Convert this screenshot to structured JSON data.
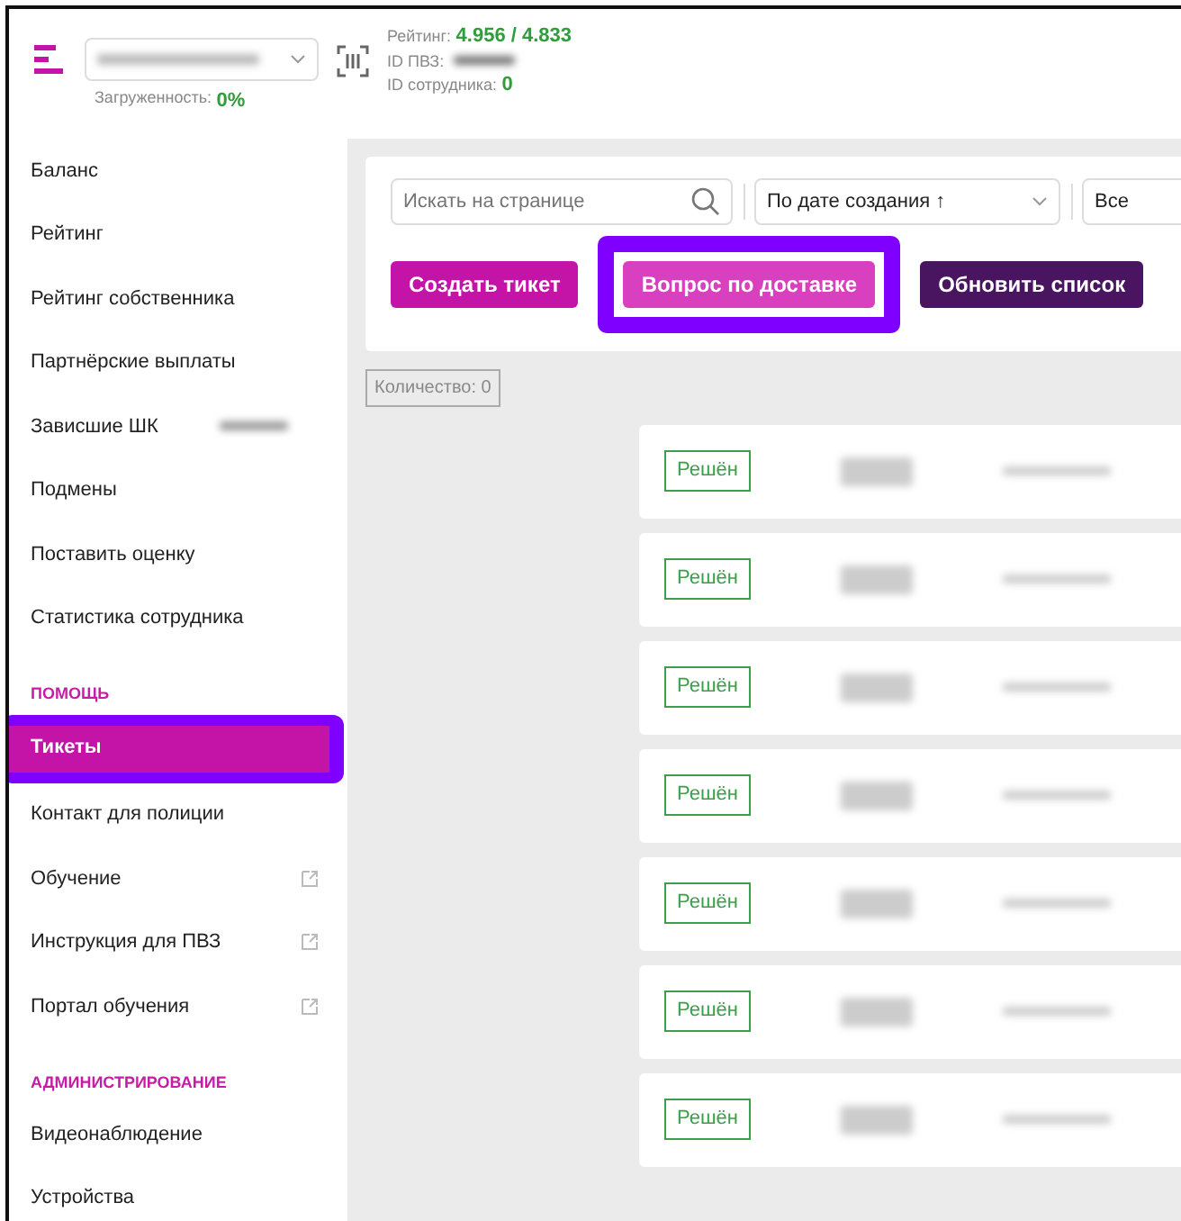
{
  "header": {
    "load_label": "Загруженность:",
    "load_value": "0%",
    "rating_label": "Рейтинг:",
    "rating_value": "4.956 / 4.833",
    "pvz_label": "ID ПВЗ:",
    "employee_label": "ID сотрудника:",
    "employee_value": "0"
  },
  "sidebar": {
    "items": [
      {
        "kind": "item",
        "label": "Баланс",
        "selected": false
      },
      {
        "kind": "item",
        "label": "Рейтинг",
        "selected": false
      },
      {
        "kind": "item",
        "label": "Рейтинг собственника",
        "selected": false
      },
      {
        "kind": "item",
        "label": "Партнёрские выплаты",
        "selected": false
      },
      {
        "kind": "redacted",
        "label": "Зависшие ШК",
        "selected": false
      },
      {
        "kind": "item",
        "label": "Подмены",
        "selected": false
      },
      {
        "kind": "item",
        "label": "Поставить оценку",
        "selected": false
      },
      {
        "kind": "item",
        "label": "Статистика сотрудника",
        "selected": false
      },
      {
        "kind": "section",
        "label": "ПОМОЩЬ"
      },
      {
        "kind": "item",
        "label": "Тикеты",
        "selected": true,
        "highlighted": true
      },
      {
        "kind": "item",
        "label": "Контакт для полиции",
        "selected": false
      },
      {
        "kind": "external",
        "label": "Обучение",
        "selected": false
      },
      {
        "kind": "external",
        "label": "Инструкция для ПВЗ",
        "selected": false
      },
      {
        "kind": "external",
        "label": "Портал обучения",
        "selected": false
      },
      {
        "kind": "section",
        "label": "АДМИНИСТРИРОВАНИЕ"
      },
      {
        "kind": "item",
        "label": "Видеонаблюдение",
        "selected": false
      },
      {
        "kind": "item",
        "label": "Устройства",
        "selected": false
      }
    ]
  },
  "toolbar": {
    "search": {
      "placeholder": "Искать на странице"
    },
    "sort": "По дате создания ↑",
    "filter": "Все",
    "buttons": [
      {
        "kind": "pink",
        "label": "Создать тикет",
        "highlighted": false
      },
      {
        "kind": "light",
        "label": "Вопрос по доставке",
        "highlighted": true
      },
      {
        "kind": "dark",
        "label": "Обновить список",
        "highlighted": false
      }
    ]
  },
  "count": "Количество: 0",
  "tickets": [
    {
      "status": "Решён"
    },
    {
      "status": "Решён"
    },
    {
      "status": "Решён"
    },
    {
      "status": "Решён"
    },
    {
      "status": "Решён"
    },
    {
      "status": "Решён"
    },
    {
      "status": "Решён"
    }
  ]
}
